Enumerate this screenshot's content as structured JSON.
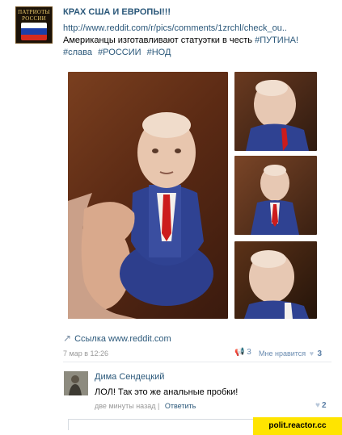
{
  "post": {
    "avatar_text": "ПАТРИОТЫ\nРОССИИ",
    "author": "КРАХ США И ЕВРОПЫ!!!",
    "link": "http://www.reddit.com/r/pics/comments/1zrchl/check_ou..",
    "text_prefix": "Американцы изготавливают статуэтки в честь ",
    "text_highlight": "#ПУТИНА!",
    "tags": [
      "#слава",
      "#РОССИИ",
      "#НОД"
    ],
    "source_link_label": "Ссылка www.reddit.com",
    "date": "7 мар в 12:26",
    "shares_count": "3",
    "likes_label": "Мне нравится",
    "likes_count": "3"
  },
  "comment": {
    "author": "Дима Сендецкий",
    "text": "ЛОЛ! Так это же анальные пробки!",
    "time": "две минуты назад",
    "separator": "|",
    "reply_label": "Ответить",
    "likes_count": "2"
  },
  "watermark": "polit.reactor.cc",
  "colors": {
    "link": "#2b587a",
    "meta": "#999999",
    "watermark_bg": "#ffe400"
  },
  "icons": {
    "share": "megaphone-icon",
    "like": "heart-icon",
    "source": "arrow-link-icon"
  }
}
